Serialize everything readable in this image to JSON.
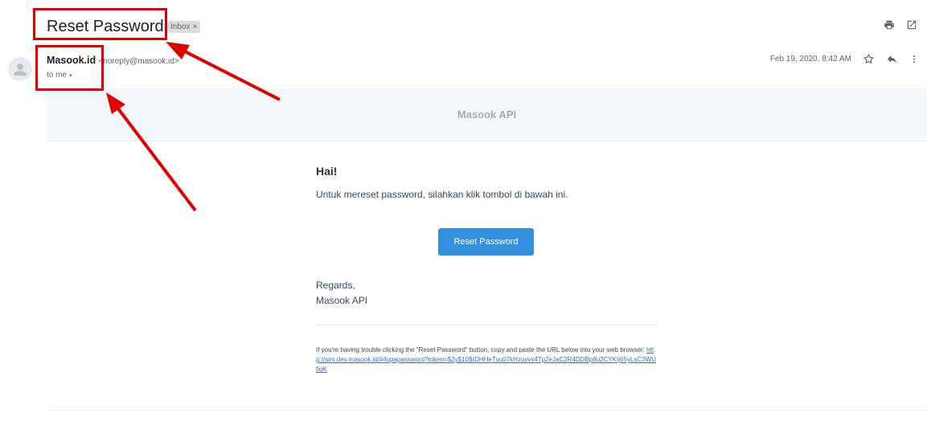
{
  "subject": "Reset Password",
  "label_badge": {
    "text": "Inbox",
    "close": "×"
  },
  "sender": {
    "name": "Masook.id",
    "email": "<noreply@masook.id>",
    "to": "to me",
    "to_caret": "▾"
  },
  "date": "Feb 19, 2020, 8:42 AM",
  "icons": [
    "print-icon",
    "open-in-new-window-icon",
    "star-icon",
    "reply-icon",
    "more-vert-icon",
    "avatar-person-icon"
  ],
  "email": {
    "brand": "Masook API",
    "greeting": "Hai!",
    "intro": "Untuk mereset password, silahkan klik tombol di bawah ini.",
    "button_label": "Reset Password",
    "regards_1": "Regards,",
    "regards_2": "Masook API",
    "subcopy_text": "If you're having trouble clicking the \"Reset Password\" button, copy and paste the URL below into your web browser: ",
    "subcopy_link": "http://sim.dev.masook.id/#/lupapassword?token=$2y$10$rDHHeTvu07kHzovvx4Tp2eJaC2R4DDBp8u2CYKIj65yLsC3WUfioK"
  },
  "colors": {
    "highlight": "#e00000",
    "button": "#3490dc",
    "header_band": "#f5f8fa",
    "link": "#3869d4"
  }
}
